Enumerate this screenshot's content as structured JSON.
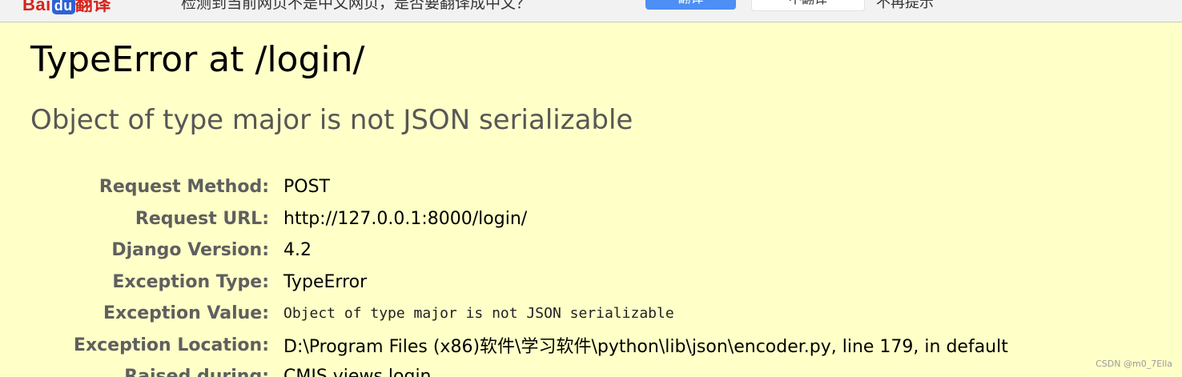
{
  "translate_bar": {
    "logo_text": "Bai",
    "logo_badge": "du",
    "logo_suffix": "翻译",
    "prompt": "检测到当前网页不是中文网页，是否要翻译成中文？",
    "translate_button": "翻译",
    "no_translate_button": "不翻译",
    "no_prompt": "不再提示"
  },
  "error": {
    "title": "TypeError at /login/",
    "subtitle": "Object of type major is not JSON serializable",
    "meta": [
      {
        "label": "Request Method:",
        "value": "POST"
      },
      {
        "label": "Request URL:",
        "value": "http://127.0.0.1:8000/login/"
      },
      {
        "label": "Django Version:",
        "value": "4.2"
      },
      {
        "label": "Exception Type:",
        "value": "TypeError"
      },
      {
        "label": "Exception Value:",
        "value": "Object of type major is not JSON serializable"
      },
      {
        "label": "Exception Location:",
        "value": "D:\\Program Files (x86)软件\\学习软件\\python\\lib\\json\\encoder.py, line 179, in default"
      },
      {
        "label": "Raised during:",
        "value": "CMIS.views.login"
      }
    ]
  },
  "watermark": "CSDN @m0_7Ella",
  "colors": {
    "page_background": "#ffffc8",
    "label_gray": "#5f5f5f",
    "subtitle_gray": "#575757",
    "translate_blue": "#4d8ff5",
    "logo_red": "#d7231b"
  }
}
